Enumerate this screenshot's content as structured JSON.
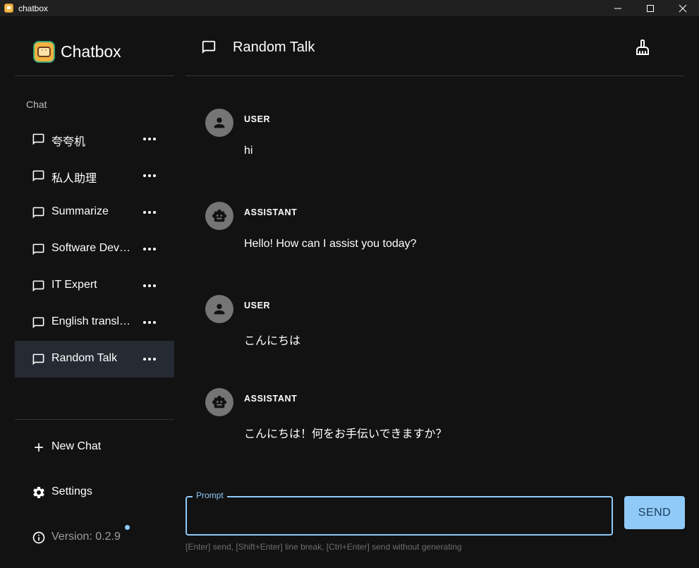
{
  "window": {
    "title": "chatbox"
  },
  "sidebar": {
    "brand_name": "Chatbox",
    "section_label": "Chat",
    "chats": [
      {
        "label": "夸夸机"
      },
      {
        "label": "私人助理"
      },
      {
        "label": "Summarize"
      },
      {
        "label": "Software Developer"
      },
      {
        "label": "IT Expert"
      },
      {
        "label": "English translator"
      },
      {
        "label": "Random Talk"
      }
    ],
    "active_chat": "Random Talk",
    "new_chat_label": "New Chat",
    "settings_label": "Settings",
    "version_label": "Version: 0.2.9"
  },
  "header": {
    "title": "Random Talk"
  },
  "messages": [
    {
      "role": "USER",
      "content": "hi"
    },
    {
      "role": "ASSISTANT",
      "content": "Hello! How can I assist you today?"
    },
    {
      "role": "USER",
      "content": "こんにちは"
    },
    {
      "role": "ASSISTANT",
      "content": "こんにちは！何をお手伝いできますか？"
    }
  ],
  "input": {
    "legend": "Prompt",
    "value": "",
    "send_label": "SEND",
    "hint": "[Enter] send, [Shift+Enter] line break, [Ctrl+Enter] send without generating"
  },
  "colors": {
    "background": "#121212",
    "accent": "#90caf9",
    "active_item": "#262b33",
    "avatar": "#757575"
  }
}
